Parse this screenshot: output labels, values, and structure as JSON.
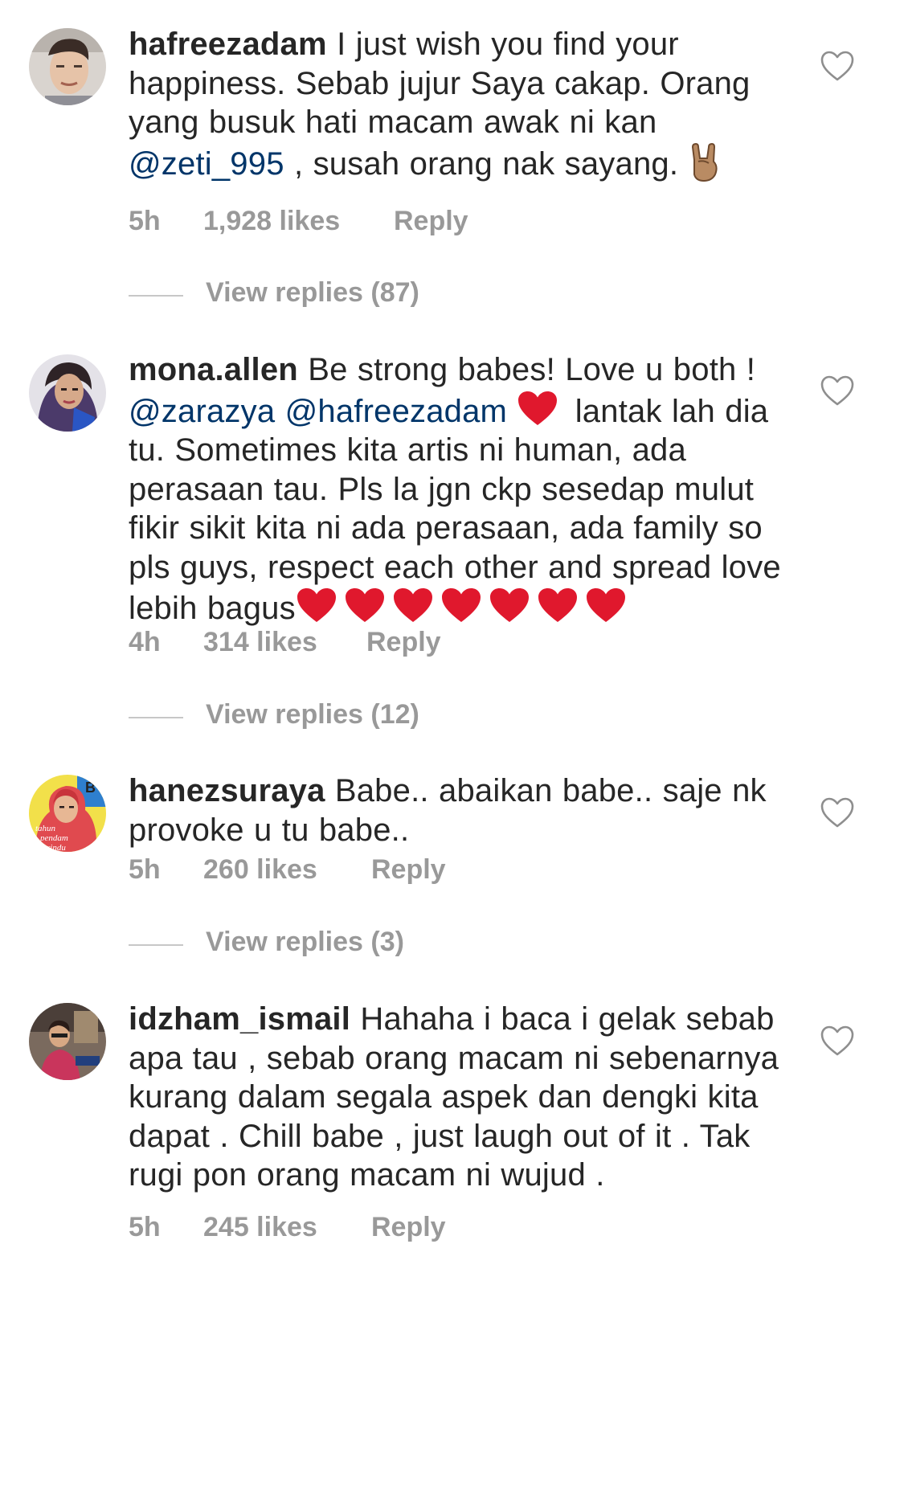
{
  "comments": [
    {
      "username": "hafreezadam",
      "segments": [
        {
          "type": "text",
          "text": " I just wish you find your happiness. Sebab jujur Saya cakap. Orang yang busuk hati macam awak ni kan "
        },
        {
          "type": "mention",
          "text": "@zeti_995"
        },
        {
          "type": "text",
          "text": " , susah orang nak sayang. "
        }
      ],
      "time": "5h",
      "likes": "1,928 likes",
      "reply": "Reply",
      "view_replies": "View replies (87)"
    },
    {
      "username": "mona.allen",
      "segments": [
        {
          "type": "text",
          "text": " Be strong babes! Love u both ! "
        },
        {
          "type": "mention",
          "text": "@zarazya"
        },
        {
          "type": "text",
          "text": " "
        },
        {
          "type": "mention",
          "text": "@hafreezadam"
        },
        {
          "type": "text",
          "text": " "
        },
        {
          "type": "text",
          "text": " lantak lah dia tu. Sometimes kita artis ni human, ada perasaan tau. Pls la jgn ckp sesedap mulut fikir sikit kita ni ada perasaan, ada family so pls guys, respect each other and spread love lebih bagus"
        }
      ],
      "time": "4h",
      "likes": "314 likes",
      "reply": "Reply",
      "view_replies": "View replies (12)"
    },
    {
      "username": "hanezsuraya",
      "segments": [
        {
          "type": "text",
          "text": " Babe.. abaikan babe.. saje nk provoke u tu babe.."
        }
      ],
      "time": "5h",
      "likes": "260 likes",
      "reply": "Reply",
      "view_replies": "View replies (3)"
    },
    {
      "username": "idzham_ismail",
      "segments": [
        {
          "type": "text",
          "text": " Hahaha i baca i gelak sebab apa tau , sebab orang macam ni sebenarnya kurang dalam segala aspek dan dengki kita dapat . Chill babe , just laugh out of it . Tak rugi pon orang macam ni wujud ."
        }
      ],
      "time": "5h",
      "likes": "245 likes",
      "reply": "Reply"
    }
  ],
  "colors": {
    "text": "#262626",
    "mention": "#003569",
    "meta": "#999999",
    "divider": "#c7c7c7",
    "heart_emoji": "#e0182d"
  },
  "icons": {
    "like": "heart-outline-icon",
    "emoji_heart": "red-heart-emoji",
    "emoji_horns": "sign-of-horns-emoji"
  }
}
